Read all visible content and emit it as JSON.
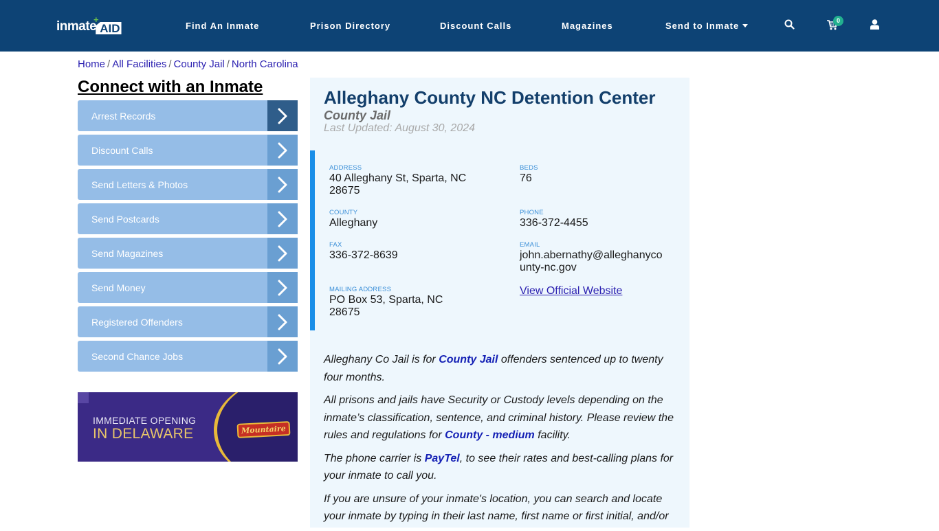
{
  "header": {
    "logo_text": "inmate",
    "logo_accent": "AID",
    "nav": [
      {
        "label": "Find An Inmate"
      },
      {
        "label": "Prison Directory"
      },
      {
        "label": "Discount Calls"
      },
      {
        "label": "Magazines"
      },
      {
        "label": "Send to Inmate"
      }
    ],
    "cart_count": "0",
    "icons": {
      "search": "search-icon",
      "cart": "cart-icon",
      "user": "user-icon",
      "caret": "caret-down-icon"
    }
  },
  "breadcrumb": [
    {
      "label": "Home"
    },
    {
      "label": "All Facilities"
    },
    {
      "label": "County Jail"
    },
    {
      "label": "North Carolina"
    }
  ],
  "breadcrumb_sep": "/",
  "sidebar": {
    "title": "Connect with an Inmate",
    "items": [
      {
        "label": "Arrest Records"
      },
      {
        "label": "Discount Calls"
      },
      {
        "label": "Send Letters & Photos"
      },
      {
        "label": "Send Postcards"
      },
      {
        "label": "Send Magazines"
      },
      {
        "label": "Send Money"
      },
      {
        "label": "Registered Offenders"
      },
      {
        "label": "Second Chance Jobs"
      }
    ]
  },
  "ad": {
    "line1": "IMMEDIATE OPENING",
    "line2": "IN DELAWARE",
    "brand": "Mountaire"
  },
  "facility": {
    "name": "Alleghany County NC Detention Center",
    "type": "County Jail",
    "last_updated": "Last Updated: August 30, 2024",
    "fields": {
      "address": {
        "label": "ADDRESS",
        "value": "40 Alleghany St, Sparta, NC 28675"
      },
      "beds": {
        "label": "BEDS",
        "value": "76"
      },
      "county": {
        "label": "COUNTY",
        "value": "Alleghany"
      },
      "phone": {
        "label": "PHONE",
        "value": "336-372-4455"
      },
      "fax": {
        "label": "FAX",
        "value": "336-372-8639"
      },
      "email": {
        "label": "EMAIL",
        "value": "john.abernathy@alleghanycounty-nc.gov"
      },
      "mailing": {
        "label": "MAILING ADDRESS",
        "value": "PO Box 53, Sparta, NC 28675"
      }
    },
    "website_label": "View Official Website"
  },
  "description": {
    "p1": {
      "pre": "Alleghany Co Jail is for ",
      "link": "County Jail",
      "post": " offenders sentenced up to twenty four months."
    },
    "p2": {
      "pre": "All prisons and jails have Security or Custody levels depending on the inmate’s classification, sentence, and criminal history. Please review the rules and regulations for ",
      "link": "County - medium",
      "post": " facility."
    },
    "p3": {
      "pre": "The phone carrier is ",
      "link": "PayTel",
      "post": ", to see their rates and best-calling plans for your inmate to call you."
    },
    "p4": {
      "text": "If you are unsure of your inmate's location, you can search and locate your inmate by typing in their last name, first name or first initial, and/or"
    }
  },
  "colors": {
    "header_bg": "#0d4375",
    "panel_bg": "#eef7fd",
    "accent_bar": "#1a8ee8",
    "sidebar_item": "#95bde7",
    "sidebar_arrow": "#6a9fd2",
    "sidebar_arrow_active": "#2f5d8a",
    "badge": "#22b08f"
  }
}
